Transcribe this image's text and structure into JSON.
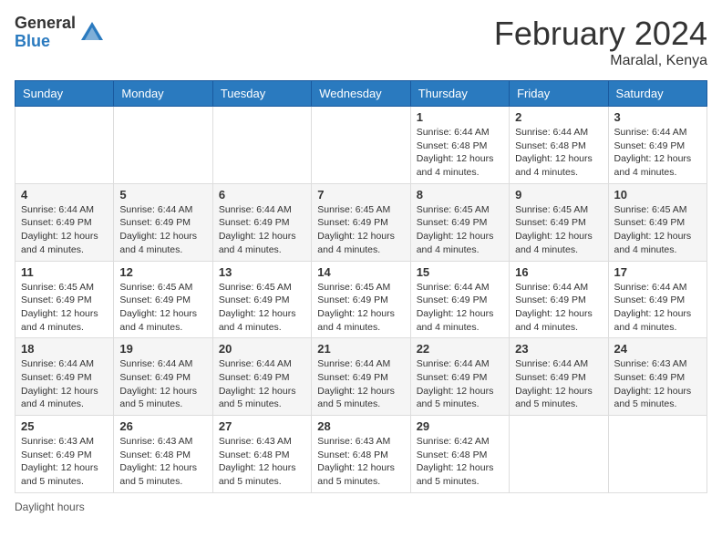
{
  "header": {
    "logo_general": "General",
    "logo_blue": "Blue",
    "month_title": "February 2024",
    "location": "Maralal, Kenya"
  },
  "weekdays": [
    "Sunday",
    "Monday",
    "Tuesday",
    "Wednesday",
    "Thursday",
    "Friday",
    "Saturday"
  ],
  "weeks": [
    [
      {
        "day": "",
        "info": ""
      },
      {
        "day": "",
        "info": ""
      },
      {
        "day": "",
        "info": ""
      },
      {
        "day": "",
        "info": ""
      },
      {
        "day": "1",
        "info": "Sunrise: 6:44 AM\nSunset: 6:48 PM\nDaylight: 12 hours and 4 minutes."
      },
      {
        "day": "2",
        "info": "Sunrise: 6:44 AM\nSunset: 6:48 PM\nDaylight: 12 hours and 4 minutes."
      },
      {
        "day": "3",
        "info": "Sunrise: 6:44 AM\nSunset: 6:49 PM\nDaylight: 12 hours and 4 minutes."
      }
    ],
    [
      {
        "day": "4",
        "info": "Sunrise: 6:44 AM\nSunset: 6:49 PM\nDaylight: 12 hours and 4 minutes."
      },
      {
        "day": "5",
        "info": "Sunrise: 6:44 AM\nSunset: 6:49 PM\nDaylight: 12 hours and 4 minutes."
      },
      {
        "day": "6",
        "info": "Sunrise: 6:44 AM\nSunset: 6:49 PM\nDaylight: 12 hours and 4 minutes."
      },
      {
        "day": "7",
        "info": "Sunrise: 6:45 AM\nSunset: 6:49 PM\nDaylight: 12 hours and 4 minutes."
      },
      {
        "day": "8",
        "info": "Sunrise: 6:45 AM\nSunset: 6:49 PM\nDaylight: 12 hours and 4 minutes."
      },
      {
        "day": "9",
        "info": "Sunrise: 6:45 AM\nSunset: 6:49 PM\nDaylight: 12 hours and 4 minutes."
      },
      {
        "day": "10",
        "info": "Sunrise: 6:45 AM\nSunset: 6:49 PM\nDaylight: 12 hours and 4 minutes."
      }
    ],
    [
      {
        "day": "11",
        "info": "Sunrise: 6:45 AM\nSunset: 6:49 PM\nDaylight: 12 hours and 4 minutes."
      },
      {
        "day": "12",
        "info": "Sunrise: 6:45 AM\nSunset: 6:49 PM\nDaylight: 12 hours and 4 minutes."
      },
      {
        "day": "13",
        "info": "Sunrise: 6:45 AM\nSunset: 6:49 PM\nDaylight: 12 hours and 4 minutes."
      },
      {
        "day": "14",
        "info": "Sunrise: 6:45 AM\nSunset: 6:49 PM\nDaylight: 12 hours and 4 minutes."
      },
      {
        "day": "15",
        "info": "Sunrise: 6:44 AM\nSunset: 6:49 PM\nDaylight: 12 hours and 4 minutes."
      },
      {
        "day": "16",
        "info": "Sunrise: 6:44 AM\nSunset: 6:49 PM\nDaylight: 12 hours and 4 minutes."
      },
      {
        "day": "17",
        "info": "Sunrise: 6:44 AM\nSunset: 6:49 PM\nDaylight: 12 hours and 4 minutes."
      }
    ],
    [
      {
        "day": "18",
        "info": "Sunrise: 6:44 AM\nSunset: 6:49 PM\nDaylight: 12 hours and 4 minutes."
      },
      {
        "day": "19",
        "info": "Sunrise: 6:44 AM\nSunset: 6:49 PM\nDaylight: 12 hours and 5 minutes."
      },
      {
        "day": "20",
        "info": "Sunrise: 6:44 AM\nSunset: 6:49 PM\nDaylight: 12 hours and 5 minutes."
      },
      {
        "day": "21",
        "info": "Sunrise: 6:44 AM\nSunset: 6:49 PM\nDaylight: 12 hours and 5 minutes."
      },
      {
        "day": "22",
        "info": "Sunrise: 6:44 AM\nSunset: 6:49 PM\nDaylight: 12 hours and 5 minutes."
      },
      {
        "day": "23",
        "info": "Sunrise: 6:44 AM\nSunset: 6:49 PM\nDaylight: 12 hours and 5 minutes."
      },
      {
        "day": "24",
        "info": "Sunrise: 6:43 AM\nSunset: 6:49 PM\nDaylight: 12 hours and 5 minutes."
      }
    ],
    [
      {
        "day": "25",
        "info": "Sunrise: 6:43 AM\nSunset: 6:49 PM\nDaylight: 12 hours and 5 minutes."
      },
      {
        "day": "26",
        "info": "Sunrise: 6:43 AM\nSunset: 6:48 PM\nDaylight: 12 hours and 5 minutes."
      },
      {
        "day": "27",
        "info": "Sunrise: 6:43 AM\nSunset: 6:48 PM\nDaylight: 12 hours and 5 minutes."
      },
      {
        "day": "28",
        "info": "Sunrise: 6:43 AM\nSunset: 6:48 PM\nDaylight: 12 hours and 5 minutes."
      },
      {
        "day": "29",
        "info": "Sunrise: 6:42 AM\nSunset: 6:48 PM\nDaylight: 12 hours and 5 minutes."
      },
      {
        "day": "",
        "info": ""
      },
      {
        "day": "",
        "info": ""
      }
    ]
  ],
  "footer": {
    "daylight_label": "Daylight hours"
  }
}
